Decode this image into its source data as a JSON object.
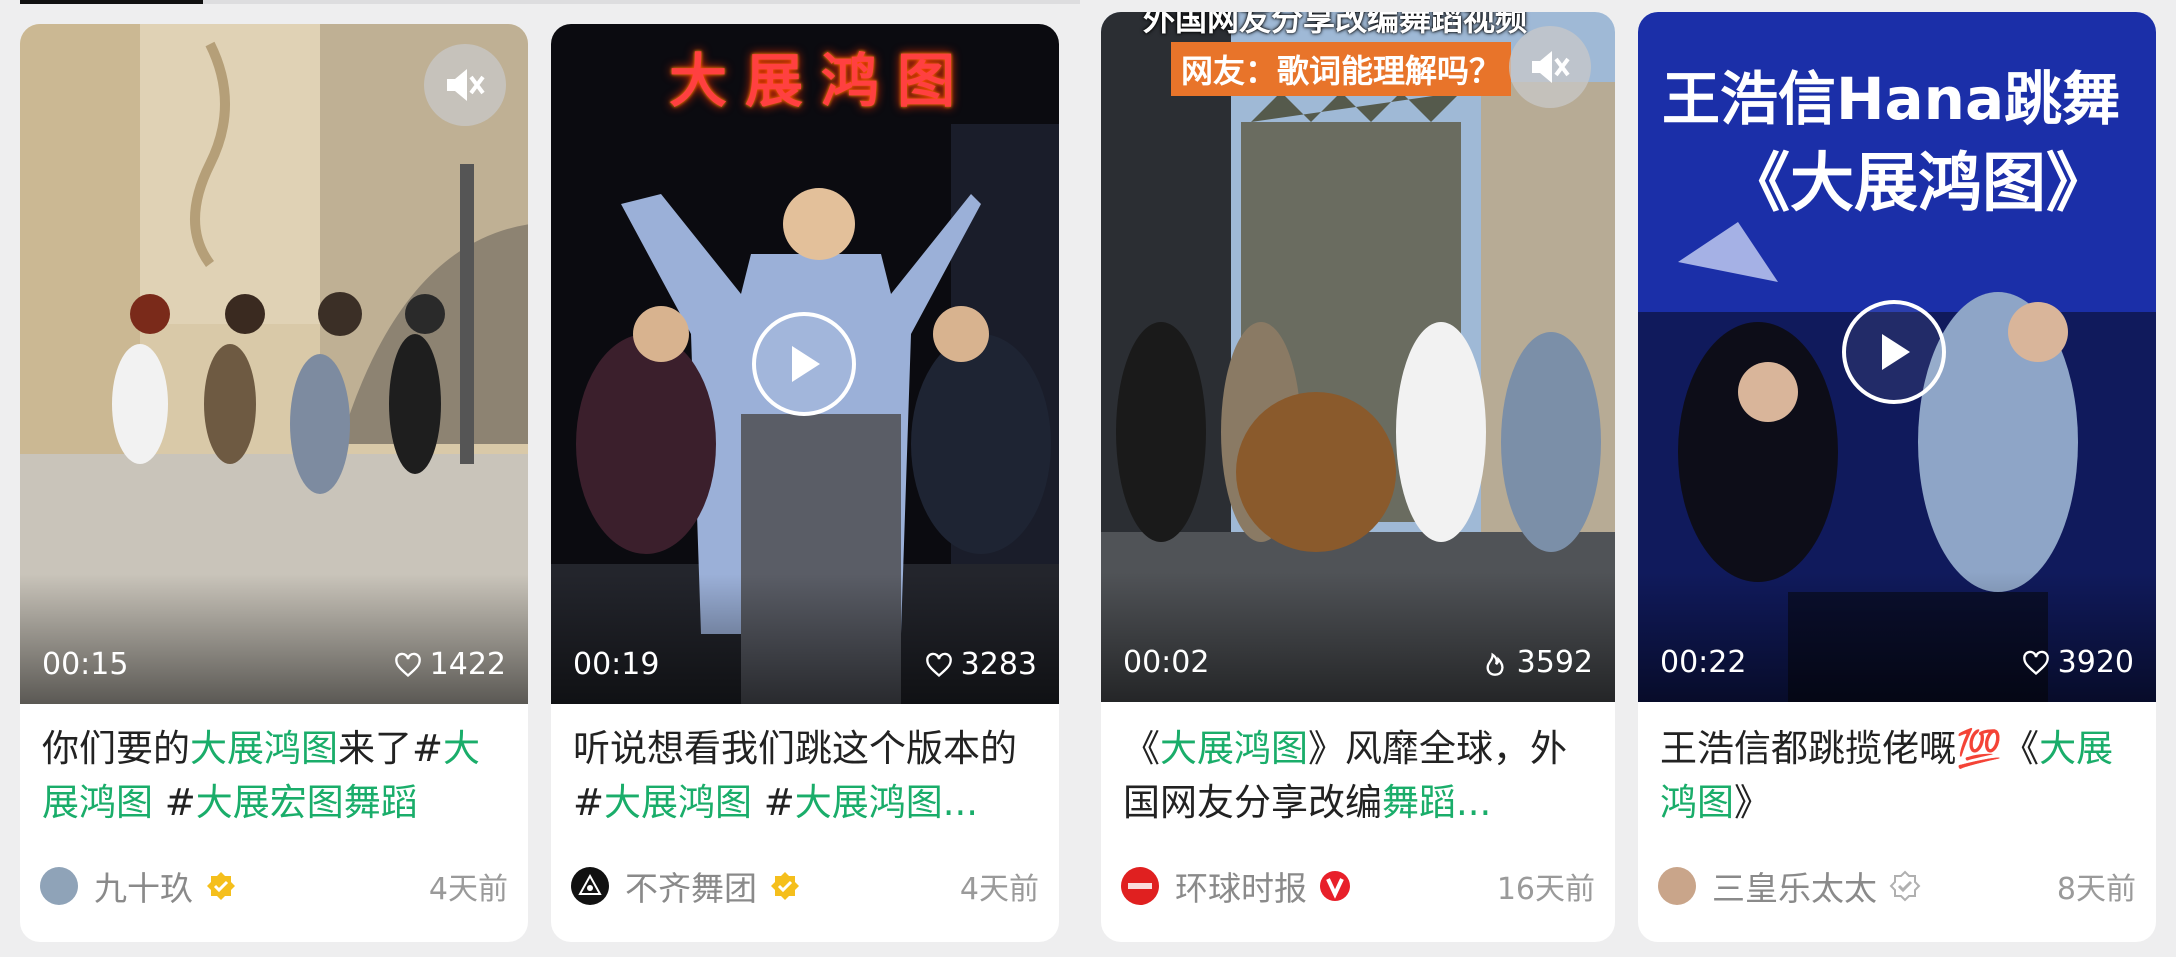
{
  "cards": [
    {
      "duration": "00:15",
      "stat_value": "1422",
      "stat_icon": "heart-icon",
      "title_parts": [
        {
          "text": "你们要的",
          "tag": false
        },
        {
          "text": "大展鸿图",
          "tag": true
        },
        {
          "text": "来了#",
          "tag": false
        },
        {
          "text": "大展鸿图",
          "tag": true
        },
        {
          "text": " #",
          "tag": false
        },
        {
          "text": "大展宏图舞蹈",
          "tag": true
        }
      ],
      "author": "九十玖",
      "badge": "gold-verified-icon",
      "time": "4天前"
    },
    {
      "duration": "00:19",
      "stat_value": "3283",
      "stat_icon": "heart-icon",
      "video_overlay_text": "大展鸿图",
      "title_parts": [
        {
          "text": "听说想看我们跳这个版本的 #",
          "tag": false
        },
        {
          "text": "大展鸿图",
          "tag": true
        },
        {
          "text": " #",
          "tag": false
        },
        {
          "text": "大展鸿图...",
          "tag": true
        }
      ],
      "author": "不齐舞团",
      "badge": "gold-verified-icon",
      "time": "4天前"
    },
    {
      "duration": "00:02",
      "stat_value": "3592",
      "stat_icon": "flame-icon",
      "video_caption_line1": "外国网友分享改编舞蹈视频",
      "video_caption_line2": "网友：歌词能理解吗？",
      "title_parts": [
        {
          "text": "《",
          "tag": false
        },
        {
          "text": "大展鸿图",
          "tag": true
        },
        {
          "text": "》风靡全球，外国网友分享改编",
          "tag": false
        },
        {
          "text": "舞蹈...",
          "tag": true
        }
      ],
      "author": "环球时报",
      "badge": "red-v-icon",
      "time": "16天前"
    },
    {
      "duration": "00:22",
      "stat_value": "3920",
      "stat_icon": "heart-icon",
      "video_caption_line1": "王浩信Hana跳舞",
      "video_caption_line2": "《大展鸿图》",
      "title_parts": [
        {
          "text": "王浩信都跳揽佬嘅💯《",
          "tag": false
        },
        {
          "text": "大展鸿图",
          "tag": true
        },
        {
          "text": "》",
          "tag": false
        }
      ],
      "author": "三皇乐太太",
      "badge": "grey-verified-icon",
      "time": "8天前"
    }
  ],
  "colors": {
    "tag_green": "#1aad6a",
    "badge_gold": "#f5bf1c",
    "badge_red": "#e8202a"
  }
}
